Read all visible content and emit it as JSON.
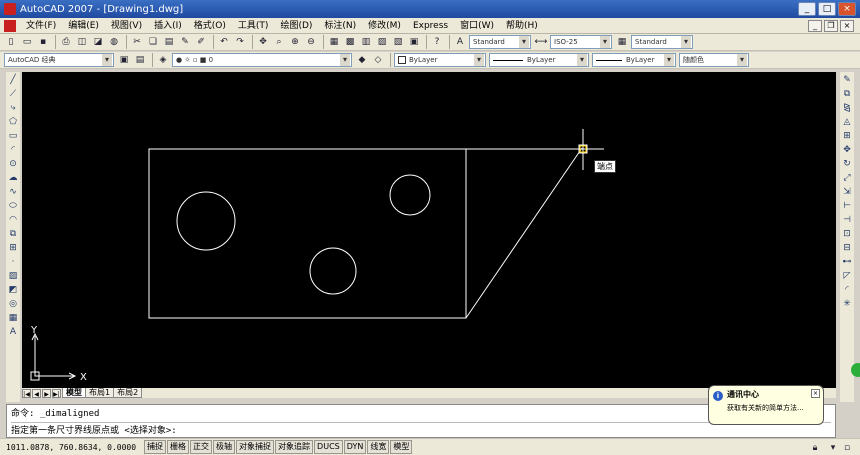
{
  "window": {
    "title": "AutoCAD 2007 - [Drawing1.dwg]"
  },
  "menu": [
    "文件(F)",
    "编辑(E)",
    "视图(V)",
    "插入(I)",
    "格式(O)",
    "工具(T)",
    "绘图(D)",
    "标注(N)",
    "修改(M)",
    "Express",
    "窗口(W)",
    "帮助(H)"
  ],
  "toolbar1": {
    "text_style": "Standard",
    "dim_style": "ISO-25",
    "table_style": "Standard"
  },
  "toolbar2": {
    "workspace": "AutoCAD 经典",
    "layer": "0",
    "color": "ByLayer",
    "linetype": "ByLayer",
    "lineweight": "ByLayer",
    "plot_style": "随颜色"
  },
  "canvas": {
    "tooltip": "端点",
    "ucs_x": "X",
    "ucs_y": "Y"
  },
  "tabs": [
    "模型",
    "布局1",
    "布局2"
  ],
  "command": {
    "line1": "命令: _dimaligned",
    "line2": "指定第一条尺寸界线原点或 <选择对象>:"
  },
  "status": {
    "coords": "1011.0878, 760.8634, 0.0000",
    "buttons": [
      "捕捉",
      "栅格",
      "正交",
      "极轴",
      "对象捕捉",
      "对象追踪",
      "DUCS",
      "DYN",
      "线宽",
      "模型"
    ]
  },
  "notification": {
    "title": "通讯中心",
    "text": "获取有关新的简单方法..."
  },
  "colors": {
    "canvas": "#000000",
    "title_bar": "#1f4aa0",
    "drawing_lines": "#ffffff"
  }
}
